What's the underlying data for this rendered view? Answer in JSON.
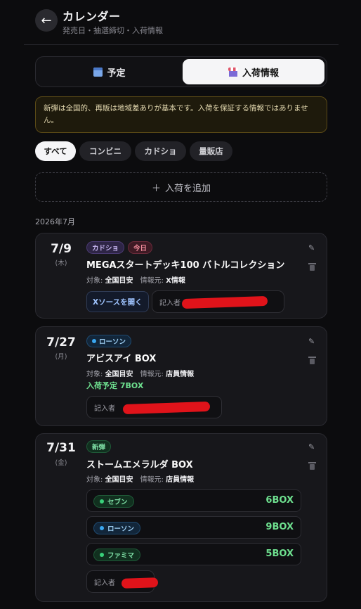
{
  "header": {
    "back_glyph": "←",
    "title": "カレンダー",
    "subtitle": "発売日・抽選締切・入荷情報"
  },
  "tabs": [
    {
      "label": "予定",
      "icon": "calendar-icon",
      "active": false
    },
    {
      "label": "入荷情報",
      "icon": "store-icon",
      "active": true
    }
  ],
  "notice": "新弾は全国的、再販は地域差ありが基本です。入荷を保証する情報ではありません。",
  "filters": [
    "すべて",
    "コンビニ",
    "カドショ",
    "量販店"
  ],
  "add_button": {
    "plus": "＋",
    "label": "入荷を追加"
  },
  "month_label": "2026年7月",
  "colors": {
    "accent_green": "#6ee08f",
    "seven_dot": "#39d07a",
    "lawson_dot": "#3aa7f0",
    "famima_dot": "#39d07a"
  },
  "entries": [
    {
      "date": "7/9",
      "dow": "(木)",
      "badges": [
        "カドショ",
        "今日"
      ],
      "product": "MEGAスタートデッキ100 バトルコレクション",
      "target_label": "対象:",
      "target": "全国目安",
      "source_label": "情報元:",
      "source": "X情報",
      "source_button": "Xソースを開く",
      "reporter_label": "記入者"
    },
    {
      "date": "7/27",
      "dow": "(月)",
      "badges": [
        "ローソン"
      ],
      "product": "アビスアイ BOX",
      "target_label": "対象:",
      "target": "全国目安",
      "source_label": "情報元:",
      "source": "店員情報",
      "eta": "入荷予定 7BOX",
      "reporter_label": "記入者"
    },
    {
      "date": "7/31",
      "dow": "(金)",
      "badges": [
        "新弾"
      ],
      "product": "ストームエメラルダ BOX",
      "target_label": "対象:",
      "target": "全国目安",
      "source_label": "情報元:",
      "source": "店員情報",
      "stores": [
        {
          "name": "セブン",
          "qty": "6BOX"
        },
        {
          "name": "ローソン",
          "qty": "9BOX"
        },
        {
          "name": "ファミマ",
          "qty": "5BOX"
        }
      ],
      "reporter_label": "記入者"
    }
  ]
}
